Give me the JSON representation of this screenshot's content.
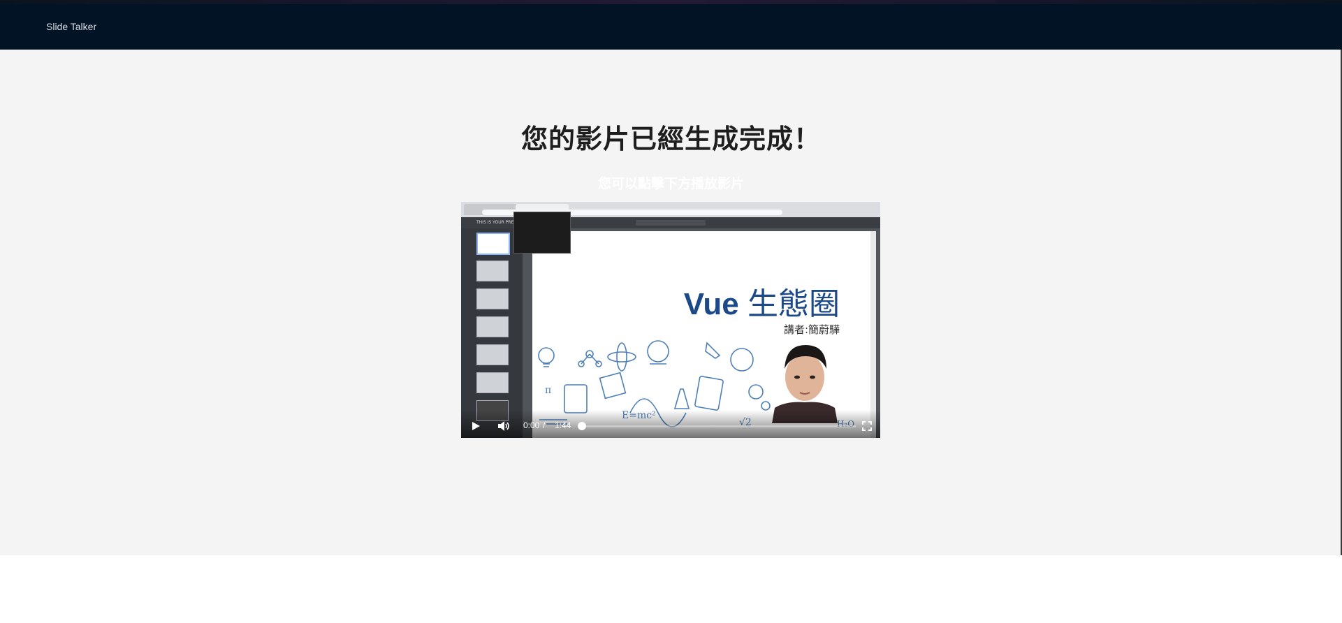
{
  "navbar": {
    "brand": "Slide Talker"
  },
  "page": {
    "title": "您的影片已經生成完成！",
    "subtitle": "您可以點擊下方播放影片"
  },
  "video": {
    "slide_title_latin": "Vue",
    "slide_title_cjk": "生態圈",
    "slide_author": "講者:簡蔚驊",
    "pdf_header": "THIS IS YOUR PRESENTATION",
    "current_time": "0:00",
    "separator": "/",
    "duration": "1:44",
    "progress_fraction": 0.0,
    "icons": [
      "play-icon",
      "volume-icon",
      "fullscreen-icon"
    ],
    "accent_color": "#1c4a88"
  }
}
